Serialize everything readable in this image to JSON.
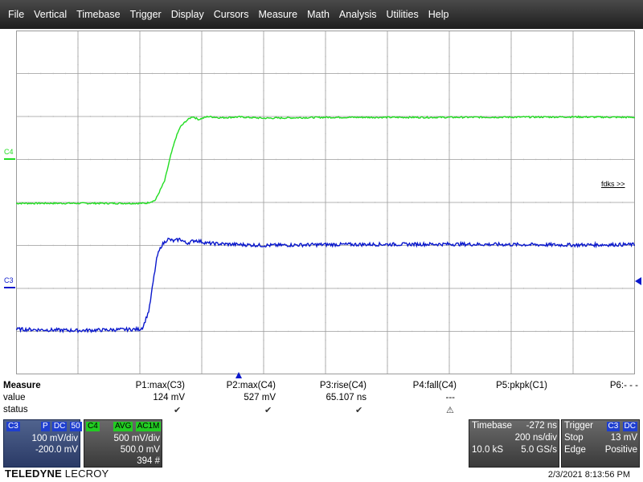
{
  "menu": [
    "File",
    "Vertical",
    "Timebase",
    "Trigger",
    "Display",
    "Cursors",
    "Measure",
    "Math",
    "Analysis",
    "Utilities",
    "Help"
  ],
  "colors": {
    "c3": "#0a18cc",
    "c4": "#22dd22",
    "grid": "#9a9a9a",
    "dots": "#b0b0b0"
  },
  "channels": {
    "c3_label": "C3",
    "c4_label": "C4"
  },
  "overlay_text": "fdks >>",
  "measure": {
    "title": "Measure",
    "row_value": "value",
    "row_status": "status",
    "params": [
      {
        "name": "P1:max(C3)",
        "value": "124 mV",
        "status": "check"
      },
      {
        "name": "P2:max(C4)",
        "value": "527 mV",
        "status": "check"
      },
      {
        "name": "P3:rise(C4)",
        "value": "65.107 ns",
        "status": "check"
      },
      {
        "name": "P4:fall(C4)",
        "value": "---",
        "status": "warning"
      },
      {
        "name": "P5:pkpk(C1)",
        "value": "",
        "status": ""
      },
      {
        "name": "P6:- - -",
        "value": "",
        "status": ""
      }
    ]
  },
  "c3_desc": {
    "label": "C3",
    "tag1": "P",
    "tag2": "DC",
    "tag3": "50",
    "vdiv": "100 mV/div",
    "offset": "-200.0 mV"
  },
  "c4_desc": {
    "label": "C4",
    "tag1": "AVG",
    "tag2": "AC1M",
    "vdiv": "500 mV/div",
    "offset": "500.0 mV",
    "count": "394 #"
  },
  "timebase": {
    "label": "Timebase",
    "delay": "-272 ns",
    "tdiv": "200 ns/div",
    "samples": "10.0 kS",
    "rate": "5.0 GS/s"
  },
  "trigger": {
    "label": "Trigger",
    "src": "C3",
    "coupling": "DC",
    "mode": "Stop",
    "level": "13 mV",
    "type": "Edge",
    "slope": "Positive"
  },
  "brand": {
    "name": "TELEDYNE",
    "sub": "LECROY"
  },
  "datetime": "2/3/2021 8:13:56 PM",
  "chart_data": {
    "type": "line",
    "xlim": [
      -5,
      5
    ],
    "ylim": [
      -4,
      4
    ],
    "grid": true,
    "series": [
      {
        "name": "C4",
        "x": [
          -5,
          -2.9,
          -2.75,
          -2.6,
          -2.5,
          -2.42,
          -2.35,
          -2.25,
          -2.15,
          -2.05,
          -1.9,
          -1.7,
          -1.4,
          -1,
          0,
          2,
          4,
          5
        ],
        "y": [
          -0.02,
          -0.02,
          0.05,
          0.5,
          1.1,
          1.5,
          1.75,
          1.9,
          2.0,
          1.93,
          2.0,
          1.97,
          1.99,
          1.96,
          1.98,
          1.98,
          1.99,
          1.98
        ]
      },
      {
        "name": "C3",
        "x": [
          -5,
          -4,
          -3,
          -2.95,
          -2.85,
          -2.78,
          -2.72,
          -2.65,
          -2.55,
          -2.45,
          -2.35,
          -2.25,
          -2.1,
          -1.9,
          -1.6,
          -1,
          0,
          2,
          4,
          5
        ],
        "y": [
          -2.95,
          -2.98,
          -2.95,
          -2.9,
          -2.5,
          -1.8,
          -1.25,
          -1.0,
          -0.85,
          -0.9,
          -0.85,
          -0.95,
          -0.88,
          -0.95,
          -0.97,
          -1.0,
          -0.98,
          -0.97,
          -0.99,
          -0.98
        ]
      }
    ]
  }
}
